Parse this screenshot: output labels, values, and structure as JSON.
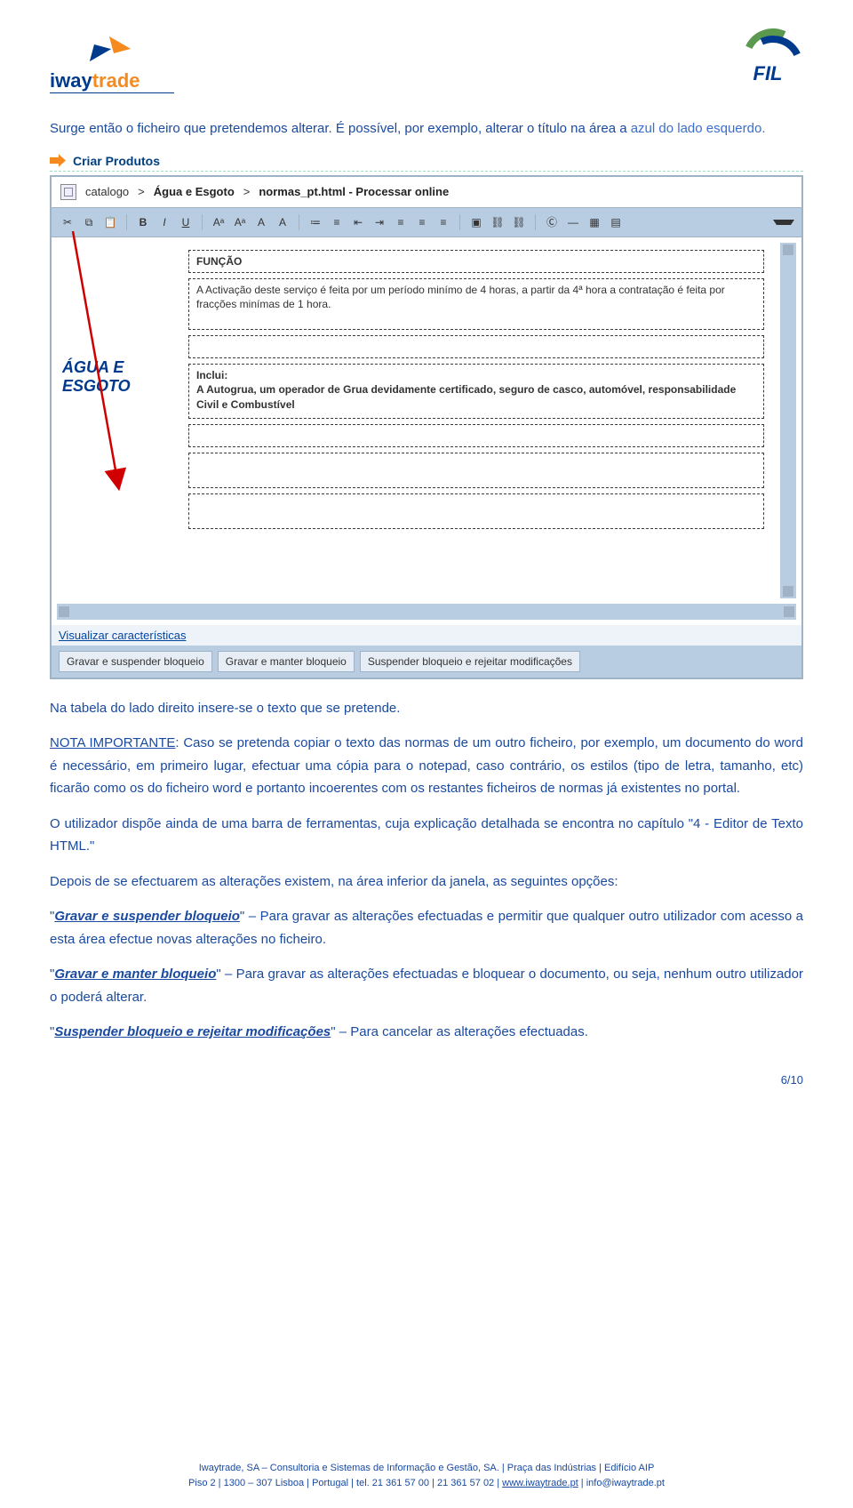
{
  "header": {
    "logo_left_line1": "iway",
    "logo_left_line2": "trade",
    "logo_right": "FIL"
  },
  "intro": {
    "p1a": "Surge então o ficheiro que pretendemos alterar. É possível, por exemplo, alterar o título na área a ",
    "p1b": "azul do lado esquerdo."
  },
  "criar": {
    "label": "Criar Produtos"
  },
  "editor": {
    "breadcrumb": {
      "seg1": "catalogo",
      "sep": ">",
      "seg2": "Água e Esgoto",
      "seg3": "normas_pt.html - Processar online"
    },
    "toolbar": {
      "cut": "✂",
      "copy": "⧉",
      "paste": "📋",
      "bold": "B",
      "italic": "I",
      "underline": "U",
      "fontup": "Aᵃ",
      "fontdn": "Aᵃ",
      "fontcol": "A",
      "bgcol": "A",
      "ul": "≔",
      "ol": "≡",
      "outdent": "⇤",
      "indent": "⇥",
      "left": "≡",
      "center": "≡",
      "right": "≡",
      "img": "▣",
      "link": "⛓",
      "unlink": "⛓",
      "sym": "Ⓒ",
      "hr": "—",
      "table": "▦",
      "tpl": "▤"
    },
    "side_title": "ÁGUA E ESGOTO",
    "fields": {
      "funcao_label": "FUNÇÃO",
      "funcao_text": "A Activação deste serviço é feita por um período minímo de 4 horas, a partir da 4ª hora a contratação é feita  por fracções minímas de 1 hora.",
      "inclui_label": "Inclui:",
      "inclui_text": "A Autogrua, um operador de Grua devidamente certificado, seguro de casco, automóvel, responsabilidade Civil e Combustível"
    },
    "link": "Visualizar características",
    "buttons": {
      "b1": "Gravar e suspender bloqueio",
      "b2": "Gravar e manter bloqueio",
      "b3": "Suspender bloqueio e rejeitar modificações"
    }
  },
  "below": {
    "p2": "Na tabela do lado direito insere-se o texto que se pretende.",
    "p3_lead": "NOTA IMPORTANTE",
    "p3": ": Caso se pretenda copiar o texto das normas de um outro ficheiro, por exemplo, um documento do word é necessário, em primeiro lugar, efectuar uma cópia para o notepad, caso contrário, os estilos (tipo de letra, tamanho, etc) ficarão como os do ficheiro word e portanto incoerentes com os restantes ficheiros de normas já existentes no portal.",
    "p4": "O utilizador dispõe ainda de uma barra de ferramentas, cuja explicação detalhada se encontra no capítulo \"4 - Editor de Texto HTML.\"",
    "p5": "Depois de se efectuarem as alterações existem, na área inferior da janela, as seguintes opções:",
    "opt1_label": "Gravar e suspender bloqueio",
    "opt1_text": " – Para gravar as alterações efectuadas e permitir que qualquer outro utilizador com acesso a esta área efectue novas alterações no ficheiro.",
    "opt2_label": "Gravar e manter bloqueio",
    "opt2_text": " – Para gravar as alterações efectuadas e bloquear o documento, ou seja, nenhum outro utilizador o poderá alterar.",
    "opt3_label": "Suspender bloqueio e rejeitar modificações",
    "opt3_text": " – Para cancelar as alterações efectuadas."
  },
  "pagenum": "6/10",
  "footer": {
    "l1": "Iwaytrade, SA – Consultoria e Sistemas de Informação e Gestão, SA. | Praça das Indústrias | Edifício AIP",
    "l2a": "Piso 2 | 1300 – 307 Lisboa | Portugal | tel. 21 361 57 00 | 21 361 57 02 | ",
    "l2b": "www.iwaytrade.pt",
    "l2c": " | info@iwaytrade.pt"
  }
}
